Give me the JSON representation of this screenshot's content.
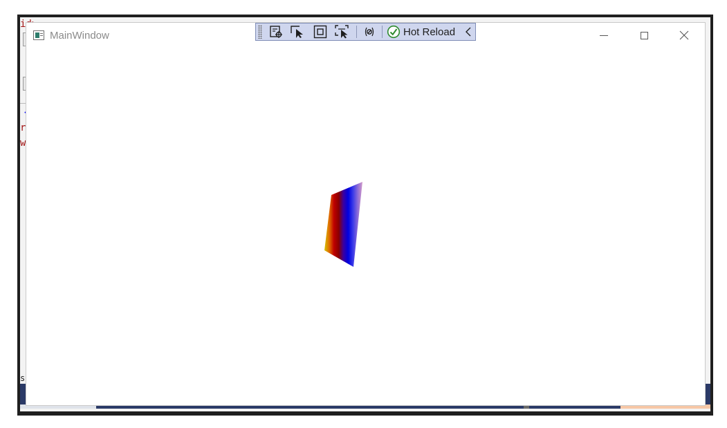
{
  "window": {
    "title": "MainWindow",
    "controls": {
      "minimize": "minimize",
      "maximize": "maximize",
      "close": "close"
    }
  },
  "toolbar": {
    "hot_reload_label": "Hot Reload",
    "icons": [
      "live-visual-tree-icon",
      "select-element-icon",
      "display-layout-adorners-icon",
      "track-focused-element-icon",
      "binding-failures-icon",
      "hot-reload-status-icon",
      "collapse-toolbar-icon"
    ]
  },
  "background_code": {
    "lines": [
      "id>",
      "<",
      "ri",
      "w>",
      "s f"
    ]
  },
  "scene": {
    "quad_gradient": [
      "#d4c200",
      "#e07000",
      "#c00000",
      "#8a0000",
      "#3a00a0",
      "#0000e0",
      "#3a3ae8",
      "#8c6cd8",
      "#d49ac8"
    ]
  }
}
